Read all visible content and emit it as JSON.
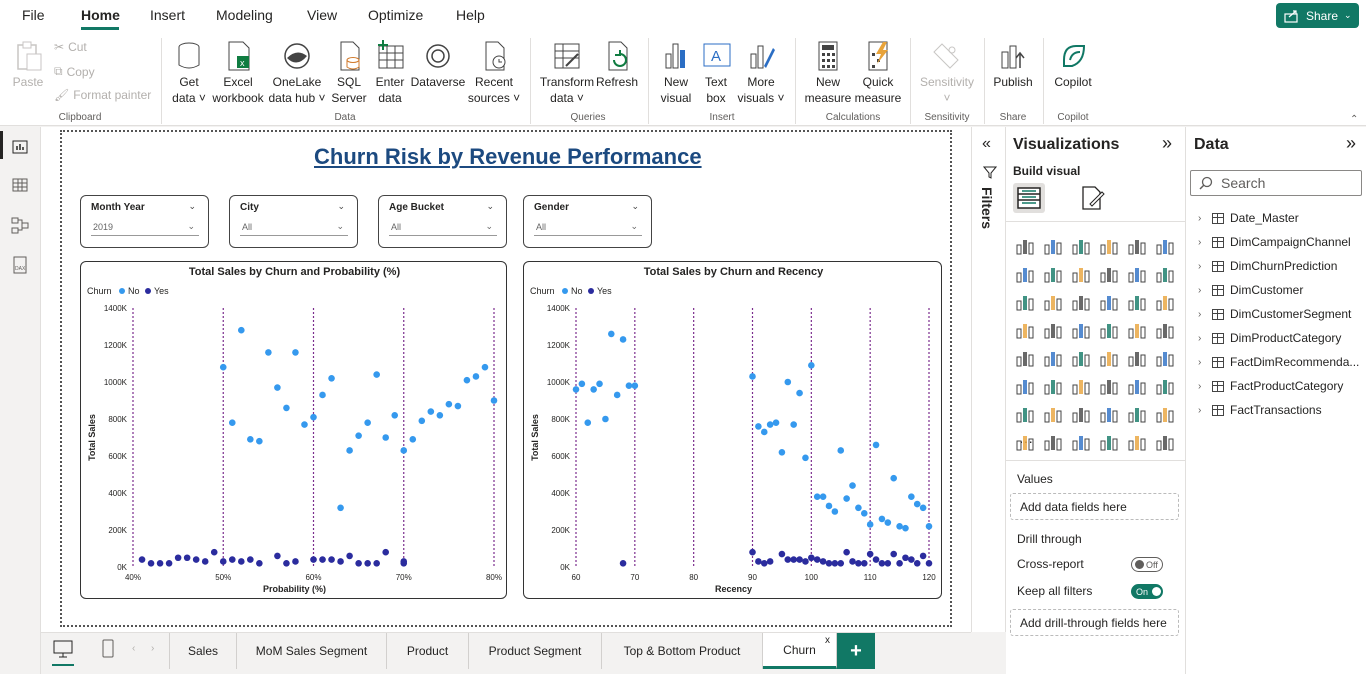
{
  "menu": {
    "file": "File",
    "home": "Home",
    "insert": "Insert",
    "modeling": "Modeling",
    "view": "View",
    "optimize": "Optimize",
    "help": "Help",
    "share": "Share"
  },
  "ribbon": {
    "paste": "Paste",
    "cut": "Cut",
    "copy": "Copy",
    "format_painter": "Format painter",
    "get_data_1": "Get",
    "get_data_2": "data ˅",
    "excel_1": "Excel",
    "excel_2": "workbook",
    "onelake_1": "OneLake",
    "onelake_2": "data hub ˅",
    "sql_1": "SQL",
    "sql_2": "Server",
    "enter_1": "Enter",
    "enter_2": "data",
    "dataverse": "Dataverse",
    "recent_1": "Recent",
    "recent_2": "sources ˅",
    "transform_1": "Transform",
    "transform_2": "data ˅",
    "refresh": "Refresh",
    "newvisual_1": "New",
    "newvisual_2": "visual",
    "textbox_1": "Text",
    "textbox_2": "box",
    "more_1": "More",
    "more_2": "visuals ˅",
    "newmeasure_1": "New",
    "newmeasure_2": "measure",
    "quick_1": "Quick",
    "quick_2": "measure",
    "sensitivity": "Sensitivity",
    "sensitivity_chev": "˅",
    "publish": "Publish",
    "copilot": "Copilot",
    "groups": {
      "clipboard": "Clipboard",
      "data": "Data",
      "queries": "Queries",
      "insert": "Insert",
      "calculations": "Calculations",
      "sensitivity": "Sensitivity",
      "share": "Share",
      "copilot": "Copilot"
    }
  },
  "report": {
    "title": "Churn Risk by Revenue Performance",
    "slicers": [
      {
        "label": "Month Year",
        "value": "2019"
      },
      {
        "label": "City",
        "value": "All"
      },
      {
        "label": "Age Bucket",
        "value": "All"
      },
      {
        "label": "Gender",
        "value": "All"
      }
    ]
  },
  "chart_data": [
    {
      "type": "scatter",
      "title": "Total Sales by Churn and Probability (%)",
      "legend_title": "Churn",
      "legend": [
        "No",
        "Yes"
      ],
      "xlabel": "Probability (%)",
      "ylabel": "Total Sales",
      "xlim": [
        40,
        80
      ],
      "ylim": [
        0,
        1400000
      ],
      "xticks": [
        "40%",
        "50%",
        "60%",
        "70%",
        "80%"
      ],
      "yticks": [
        "0K",
        "200K",
        "400K",
        "600K",
        "800K",
        "1000K",
        "1200K",
        "1400K"
      ],
      "reference_lines_x": [
        40,
        50,
        60,
        70,
        80
      ],
      "series": [
        {
          "name": "No",
          "color": "#3599ee",
          "points": [
            [
              50,
              1080000
            ],
            [
              51,
              780000
            ],
            [
              52,
              1280000
            ],
            [
              53,
              690000
            ],
            [
              54,
              680000
            ],
            [
              55,
              1160000
            ],
            [
              56,
              970000
            ],
            [
              57,
              860000
            ],
            [
              58,
              1160000
            ],
            [
              59,
              770000
            ],
            [
              60,
              810000
            ],
            [
              61,
              930000
            ],
            [
              62,
              1020000
            ],
            [
              63,
              320000
            ],
            [
              64,
              630000
            ],
            [
              65,
              710000
            ],
            [
              66,
              780000
            ],
            [
              67,
              1040000
            ],
            [
              68,
              700000
            ],
            [
              69,
              820000
            ],
            [
              70,
              630000
            ],
            [
              71,
              690000
            ],
            [
              72,
              790000
            ],
            [
              73,
              840000
            ],
            [
              74,
              820000
            ],
            [
              75,
              880000
            ],
            [
              76,
              870000
            ],
            [
              77,
              1010000
            ],
            [
              78,
              1030000
            ],
            [
              79,
              1080000
            ],
            [
              80,
              900000
            ]
          ]
        },
        {
          "name": "Yes",
          "color": "#2b2c9e",
          "points": [
            [
              41,
              40000
            ],
            [
              42,
              20000
            ],
            [
              43,
              20000
            ],
            [
              44,
              20000
            ],
            [
              45,
              50000
            ],
            [
              46,
              50000
            ],
            [
              47,
              40000
            ],
            [
              48,
              30000
            ],
            [
              49,
              80000
            ],
            [
              50,
              30000
            ],
            [
              51,
              40000
            ],
            [
              52,
              30000
            ],
            [
              53,
              40000
            ],
            [
              54,
              20000
            ],
            [
              56,
              60000
            ],
            [
              57,
              20000
            ],
            [
              58,
              30000
            ],
            [
              60,
              40000
            ],
            [
              61,
              40000
            ],
            [
              62,
              40000
            ],
            [
              63,
              30000
            ],
            [
              64,
              60000
            ],
            [
              65,
              20000
            ],
            [
              66,
              20000
            ],
            [
              67,
              20000
            ],
            [
              68,
              80000
            ],
            [
              70,
              20000
            ],
            [
              70,
              30000
            ]
          ]
        }
      ]
    },
    {
      "type": "scatter",
      "title": "Total Sales by Churn and Recency",
      "legend_title": "Churn",
      "legend": [
        "No",
        "Yes"
      ],
      "xlabel": "Recency",
      "ylabel": "Total Sales",
      "xlim": [
        60,
        120
      ],
      "ylim": [
        0,
        1400000
      ],
      "xticks": [
        "60",
        "70",
        "80",
        "90",
        "100",
        "110",
        "120"
      ],
      "yticks": [
        "0K",
        "200K",
        "400K",
        "600K",
        "800K",
        "1000K",
        "1200K",
        "1400K"
      ],
      "reference_lines_x": [
        60,
        70,
        80,
        90,
        100,
        110,
        120
      ],
      "series": [
        {
          "name": "No",
          "color": "#3599ee",
          "points": [
            [
              60,
              960000
            ],
            [
              61,
              990000
            ],
            [
              62,
              780000
            ],
            [
              63,
              960000
            ],
            [
              64,
              990000
            ],
            [
              65,
              800000
            ],
            [
              66,
              1260000
            ],
            [
              67,
              930000
            ],
            [
              68,
              1230000
            ],
            [
              69,
              980000
            ],
            [
              70,
              980000
            ],
            [
              90,
              1030000
            ],
            [
              91,
              760000
            ],
            [
              92,
              730000
            ],
            [
              93,
              770000
            ],
            [
              94,
              780000
            ],
            [
              95,
              620000
            ],
            [
              96,
              1000000
            ],
            [
              97,
              770000
            ],
            [
              98,
              940000
            ],
            [
              99,
              590000
            ],
            [
              100,
              1090000
            ],
            [
              101,
              380000
            ],
            [
              102,
              380000
            ],
            [
              103,
              330000
            ],
            [
              104,
              300000
            ],
            [
              105,
              630000
            ],
            [
              106,
              370000
            ],
            [
              107,
              440000
            ],
            [
              108,
              320000
            ],
            [
              109,
              290000
            ],
            [
              110,
              230000
            ],
            [
              111,
              660000
            ],
            [
              112,
              260000
            ],
            [
              113,
              240000
            ],
            [
              114,
              480000
            ],
            [
              115,
              220000
            ],
            [
              116,
              210000
            ],
            [
              117,
              380000
            ],
            [
              118,
              340000
            ],
            [
              119,
              320000
            ],
            [
              120,
              220000
            ]
          ]
        },
        {
          "name": "Yes",
          "color": "#2b2c9e",
          "points": [
            [
              68,
              20000
            ],
            [
              90,
              80000
            ],
            [
              91,
              30000
            ],
            [
              92,
              20000
            ],
            [
              93,
              30000
            ],
            [
              95,
              70000
            ],
            [
              96,
              40000
            ],
            [
              97,
              40000
            ],
            [
              98,
              40000
            ],
            [
              99,
              30000
            ],
            [
              100,
              50000
            ],
            [
              101,
              40000
            ],
            [
              102,
              30000
            ],
            [
              103,
              20000
            ],
            [
              104,
              20000
            ],
            [
              105,
              20000
            ],
            [
              106,
              80000
            ],
            [
              107,
              30000
            ],
            [
              108,
              20000
            ],
            [
              109,
              20000
            ],
            [
              110,
              70000
            ],
            [
              111,
              40000
            ],
            [
              112,
              20000
            ],
            [
              113,
              20000
            ],
            [
              114,
              70000
            ],
            [
              115,
              20000
            ],
            [
              116,
              50000
            ],
            [
              117,
              40000
            ],
            [
              118,
              20000
            ],
            [
              119,
              60000
            ],
            [
              120,
              20000
            ]
          ]
        }
      ]
    }
  ],
  "filters": {
    "label": "Filters"
  },
  "viz": {
    "title": "Visualizations",
    "build": "Build visual",
    "more": "···",
    "values": "Values",
    "values_placeholder": "Add data fields here",
    "drill": "Drill through",
    "cross": "Cross-report",
    "cross_state": "Off",
    "keep": "Keep all filters",
    "keep_state": "On",
    "drill_placeholder": "Add drill-through fields here"
  },
  "data": {
    "title": "Data",
    "search_placeholder": "Search",
    "tables": [
      "Date_Master",
      "DimCampaignChannel",
      "DimChurnPrediction",
      "DimCustomer",
      "DimCustomerSegment",
      "DimProductCategory",
      "FactDimRecommenda...",
      "FactProductCategory",
      "FactTransactions"
    ]
  },
  "tabs": [
    "Sales",
    "MoM Sales Segment",
    "Product",
    "Product Segment",
    "Top & Bottom Product",
    "Churn"
  ],
  "active_tab": "Churn",
  "tab_close": "x",
  "tab_add": "+"
}
